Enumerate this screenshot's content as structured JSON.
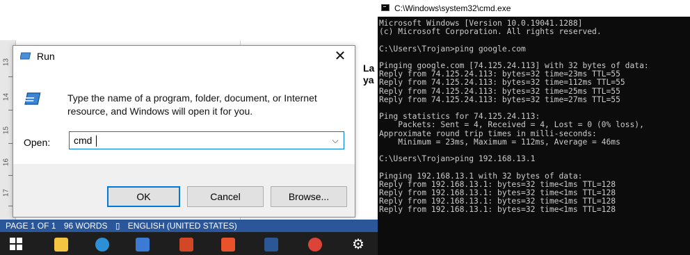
{
  "word": {
    "text_line1": "La",
    "text_line2": "ya",
    "ruler_numbers": [
      "13",
      "14",
      "15",
      "16",
      "17"
    ],
    "statusbar": {
      "page": "PAGE 1 OF 1",
      "words": "96 WORDS",
      "lang": "ENGLISH (UNITED STATES)"
    }
  },
  "taskbar": {
    "icons": [
      "windows-start-icon",
      "file-explorer-icon",
      "edge-icon",
      "photos-icon",
      "powerpoint-icon",
      "app-icon",
      "word-icon",
      "chrome-icon",
      "settings-icon"
    ]
  },
  "run_dialog": {
    "title": "Run",
    "close_glyph": "✕",
    "description": "Type the name of a program, folder, document, or Internet resource, and Windows will open it for you.",
    "open_label": "Open:",
    "open_value": "cmd",
    "dropdown_glyph": "⌵",
    "ok_label": "OK",
    "cancel_label": "Cancel",
    "browse_label": "Browse..."
  },
  "cmd": {
    "title": "C:\\Windows\\system32\\cmd.exe",
    "lines": [
      "Microsoft Windows [Version 10.0.19041.1288]",
      "(c) Microsoft Corporation. All rights reserved.",
      "",
      "C:\\Users\\Trojan>ping google.com",
      "",
      "Pinging google.com [74.125.24.113] with 32 bytes of data:",
      "Reply from 74.125.24.113: bytes=32 time=23ms TTL=55",
      "Reply from 74.125.24.113: bytes=32 time=112ms TTL=55",
      "Reply from 74.125.24.113: bytes=32 time=25ms TTL=55",
      "Reply from 74.125.24.113: bytes=32 time=27ms TTL=55",
      "",
      "Ping statistics for 74.125.24.113:",
      "    Packets: Sent = 4, Received = 4, Lost = 0 (0% loss),",
      "Approximate round trip times in milli-seconds:",
      "    Minimum = 23ms, Maximum = 112ms, Average = 46ms",
      "",
      "C:\\Users\\Trojan>ping 192.168.13.1",
      "",
      "Pinging 192.168.13.1 with 32 bytes of data:",
      "Reply from 192.168.13.1: bytes=32 time<1ms TTL=128",
      "Reply from 192.168.13.1: bytes=32 time<1ms TTL=128",
      "Reply from 192.168.13.1: bytes=32 time<1ms TTL=128",
      "Reply from 192.168.13.1: bytes=32 time<1ms TTL=128"
    ]
  },
  "colors": {
    "accent": "#0078d7",
    "statusbar": "#2b579a",
    "taskbar": "#1e1e1e",
    "console_bg": "#0c0c0c",
    "console_text": "#cccccc"
  }
}
